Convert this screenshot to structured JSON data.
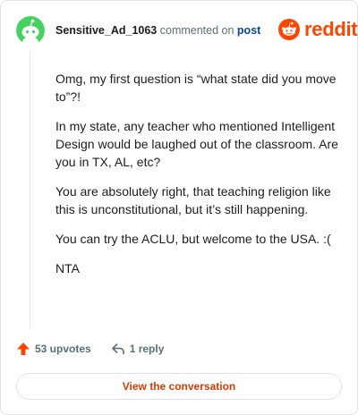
{
  "header": {
    "username": "Sensitive_Ad_1063",
    "commented_on": "commented on",
    "post_link": "post",
    "brand_word": "reddit",
    "brand_icon": "reddit-snoo-icon",
    "avatar_icon": "snoo-avatar-icon"
  },
  "comment": {
    "paragraphs": [
      "Omg, my first question is “what state did you move to”?!",
      "In my state, any teacher who mentioned Intelligent Design would be laughed out of the classroom. Are you in TX, AL, etc?",
      "You are absolutely right, that teaching religion like this is unconstitutional, but it’s still happening.",
      "You can try the ACLU, but welcome to the USA. :(",
      "NTA"
    ]
  },
  "actions": {
    "upvotes": "53 upvotes",
    "upvote_icon": "upvote-arrow-icon",
    "replies": "1 reply",
    "reply_icon": "reply-arrow-icon"
  },
  "cta": {
    "label": "View the conversation"
  },
  "colors": {
    "brand_orange": "#ff4500",
    "avatar_green": "#46d160",
    "link_blue": "#0a449b",
    "cta_text": "#d93a00"
  }
}
